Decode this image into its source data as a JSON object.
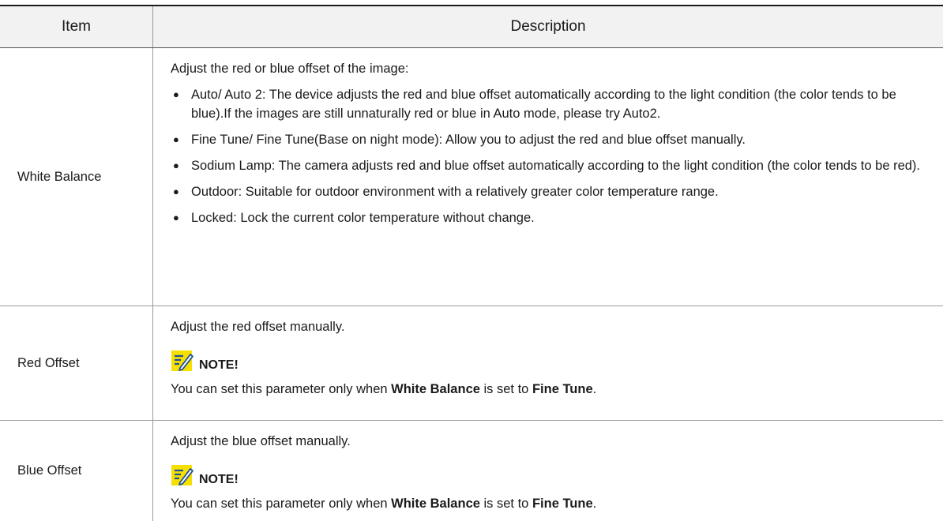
{
  "table": {
    "header": {
      "item": "Item",
      "description": "Description"
    },
    "rows": [
      {
        "item": "White Balance",
        "intro": "Adjust the red or blue offset of the image:",
        "bullets": [
          "Auto/ Auto 2: The device adjusts the red and blue offset automatically according to the light condition (the color tends to be blue).If the images are still unnaturally red or blue in Auto mode, please try Auto2.",
          "Fine Tune/ Fine Tune(Base on night mode): Allow you to adjust the red and blue offset manually.",
          "Sodium Lamp: The camera adjusts red and blue offset automatically according to the light condition (the color tends to be red).",
          "Outdoor: Suitable for outdoor environment with a relatively greater color temperature range.",
          "Locked: Lock the current color temperature without change."
        ]
      },
      {
        "item": "Red Offset",
        "intro": "Adjust the red offset manually.",
        "note_title": "NOTE!",
        "note_text_before": "You can set this parameter only when ",
        "note_bold_1": "White Balance",
        "note_text_mid": " is set to ",
        "note_bold_2": "Fine Tune",
        "note_text_end": "."
      },
      {
        "item": "Blue Offset",
        "intro": "Adjust the blue offset manually.",
        "note_title": "NOTE!",
        "note_text_before": "You can set this parameter only when ",
        "note_bold_1": "White Balance",
        "note_text_mid": " is set to ",
        "note_bold_2": "Fine Tune",
        "note_text_end": "."
      }
    ]
  },
  "icons": {
    "note": "note-pencil-icon",
    "bullet": "bullet-dot-icon"
  },
  "colors": {
    "note_icon_fill": "#f5e000",
    "note_icon_border": "#1f4fa0"
  }
}
